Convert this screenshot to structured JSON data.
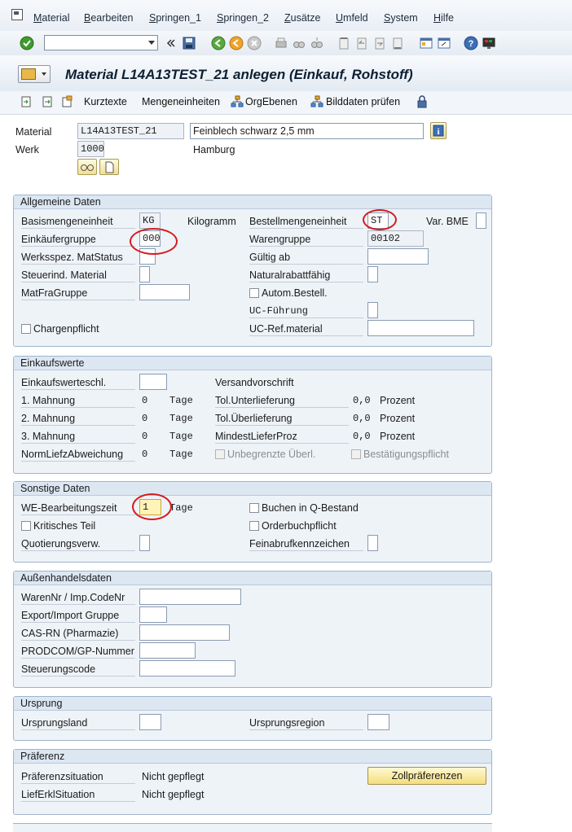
{
  "menu": {
    "items": [
      "Material",
      "Bearbeiten",
      "Springen_1",
      "Springen_2",
      "Zusätze",
      "Umfeld",
      "System",
      "Hilfe"
    ]
  },
  "toolbar": {
    "command_value": "",
    "icons": [
      "enter-icon",
      "save-icon",
      "back-icon",
      "exit-icon",
      "cancel-icon",
      "print-icon",
      "find-icon",
      "find-next-icon",
      "first-page-icon",
      "prev-page-icon",
      "next-page-icon",
      "last-page-icon",
      "create-session-icon",
      "shortcut-icon",
      "help-icon",
      "layout-icon"
    ]
  },
  "title": "Material L14A13TEST_21 anlegen (Einkauf, Rohstoff)",
  "app_toolbar": {
    "kurztexte": "Kurztexte",
    "mengeneinheiten": "Mengeneinheiten",
    "orgebenen": "OrgEbenen",
    "bilddaten": "Bilddaten prüfen"
  },
  "header": {
    "material_label": "Material",
    "material_value": "L14A13TEST_21",
    "material_desc": "Feinblech schwarz 2,5 mm",
    "werk_label": "Werk",
    "werk_value": "1000",
    "werk_name": "Hamburg"
  },
  "allgemeine": {
    "title": "Allgemeine Daten",
    "basismenge_label": "Basismengeneinheit",
    "basismenge_value": "KG",
    "basismenge_text": "Kilogramm",
    "einkaeufer_label": "Einkäufergruppe",
    "einkaeufer_value": "000",
    "werksspez_label": "Werksspez. MatStatus",
    "steuerind_label": "Steuerind. Material",
    "matfra_label": "MatFraGruppe",
    "charge_label": "Chargenpflicht",
    "bestellmenge_label": "Bestellmengeneinheit",
    "bestellmenge_value": "ST",
    "varbme_label": "Var. BME",
    "warengruppe_label": "Warengruppe",
    "warengruppe_value": "00102",
    "gueltig_label": "Gültig ab",
    "natural_label": "Naturalrabattfähig",
    "autom_label": "Autom.Bestell.",
    "ucfuehrung_label": "UC-Führung",
    "ucref_label": "UC-Ref.material"
  },
  "einkaufswerte": {
    "title": "Einkaufswerte",
    "schl_label": "Einkaufswerteschl.",
    "versand_label": "Versandvorschrift",
    "rows": [
      {
        "label": "1. Mahnung",
        "value": "0",
        "unit": "Tage",
        "right_label": "Tol.Unterlieferung",
        "right_value": "0,0",
        "right_unit": "Prozent"
      },
      {
        "label": "2. Mahnung",
        "value": "0",
        "unit": "Tage",
        "right_label": "Tol.Überlieferung",
        "right_value": "0,0",
        "right_unit": "Prozent"
      },
      {
        "label": "3. Mahnung",
        "value": "0",
        "unit": "Tage",
        "right_label": "MindestLieferProz",
        "right_value": "0,0",
        "right_unit": "Prozent"
      },
      {
        "label": "NormLiefzAbweichung",
        "value": "0",
        "unit": "Tage"
      }
    ],
    "unbegrenzt_label": "Unbegrenzte Überl.",
    "bestaetigung_label": "Bestätigungspflicht"
  },
  "sonstige": {
    "title": "Sonstige Daten",
    "we_label": "WE-Bearbeitungszeit",
    "we_value": "1",
    "we_unit": "Tage",
    "kritisch_label": "Kritisches Teil",
    "quotierung_label": "Quotierungsverw.",
    "qbestand_label": "Buchen in Q-Bestand",
    "orderbuch_label": "Orderbuchpflicht",
    "feinabruf_label": "Feinabrufkennzeichen"
  },
  "aussenhandel": {
    "title": "Außenhandelsdaten",
    "warennr_label": "WarenNr / Imp.CodeNr",
    "export_label": "Export/Import Gruppe",
    "casrn_label": "CAS-RN (Pharmazie)",
    "prodcom_label": "PRODCOM/GP-Nummer",
    "steuerung_label": "Steuerungscode"
  },
  "ursprung": {
    "title": "Ursprung",
    "land_label": "Ursprungsland",
    "region_label": "Ursprungsregion"
  },
  "praeferenz": {
    "title": "Präferenz",
    "situation_label": "Präferenzsituation",
    "situation_value": "Nicht gepflegt",
    "lieferkl_label": "LiefErklSituation",
    "lieferkl_value": "Nicht gepflegt",
    "button_label": "Zollpräferenzen"
  },
  "colors": {
    "group_bg": "#eef3f8",
    "group_border": "#9fb4cc",
    "annotation_red": "#d61c1c",
    "button_yellow": "#f4de7c"
  }
}
